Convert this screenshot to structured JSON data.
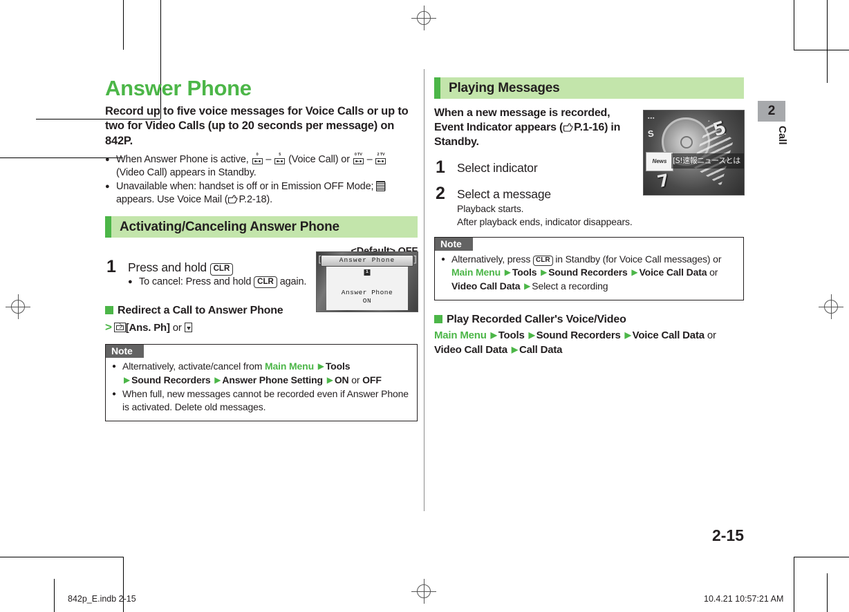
{
  "document": {
    "chapter_number": "2",
    "chapter_label": "Call",
    "page_number": "2-15",
    "footer_file": "842p_E.indb   2-15",
    "footer_timestamp": "10.4.21   10:57:21 AM",
    "accent_green": "#4cb648",
    "header_band_green": "#c3e5ab",
    "note_label_gray": "#636363",
    "tab_gray": "#a7a9ac"
  },
  "left": {
    "title": "Answer Phone",
    "lead": "Record up to five voice messages for Voice Calls or up to two for Video Calls (up to 20 seconds per message) on 842P.",
    "intro_bullets": [
      {
        "pre": "When Answer Phone is active, ",
        "icon1_sup": "0",
        "dash1": " – ",
        "icon2_sup": "5",
        "mid": " (Voice Call) or ",
        "icon3_sup": "0 TV",
        "dash2": " – ",
        "icon4_sup": "2 TV",
        "post": " (Video Call) appears in Standby."
      },
      {
        "pre": "Unavailable when: handset is off or in Emission OFF Mode; ",
        "post": " appears. Use Voice Mail (",
        "ref": "P.2-18",
        "tail": ")."
      }
    ],
    "section": {
      "heading": "Activating/Canceling Answer Phone",
      "default_line": "<Default> OFF",
      "steps": [
        {
          "num": "1",
          "head_pre": "Press and hold ",
          "head_key": "CLR",
          "bullet_pre": "To cancel: Press and hold ",
          "bullet_key": "CLR",
          "bullet_post": " again."
        }
      ],
      "screenshot": {
        "titlebar": "Answer Phone",
        "info_glyph": "i",
        "message_line1": "Answer Phone",
        "message_line2": "ON"
      }
    },
    "subsection": {
      "title": "Redirect a Call to Answer Phone",
      "path_prefix": ">",
      "path_label": "[Ans. Ph]",
      "path_or": "or"
    },
    "note": {
      "label": "Note",
      "bullets": [
        {
          "pre": "Alternatively, activate/cancel from ",
          "main_menu": "Main Menu",
          "crumbs": [
            "Tools",
            "Sound Recorders",
            "Answer Phone Setting"
          ],
          "tail_on": "ON",
          "tail_or": "or",
          "tail_off": "OFF"
        },
        {
          "text": "When full, new messages cannot be recorded even if Answer Phone is activated. Delete old messages."
        }
      ]
    }
  },
  "right": {
    "section": {
      "heading": "Playing Messages",
      "lead_pre": "When a new message is recorded, Event Indicator appears (",
      "lead_ref": "P.1-16",
      "lead_post": ") in Standby.",
      "steps": [
        {
          "num": "1",
          "head": "Select indicator",
          "subs": []
        },
        {
          "num": "2",
          "head": "Select a message",
          "subs": [
            "Playback starts.",
            "After playback ends, indicator disappears."
          ]
        }
      ],
      "screenshot": {
        "ticker": "[S!速報ニュースとは",
        "news_badge": "News",
        "dial_num_right": "5",
        "dial_num_left": "7",
        "small_s": "S"
      }
    },
    "note": {
      "label": "Note",
      "bullet": {
        "pre": "Alternatively, press ",
        "key": "CLR",
        "mid": " in Standby (for Voice Call messages) or",
        "main_menu": "Main Menu",
        "crumbs": [
          "Tools",
          "Sound Recorders",
          "Voice Call Data"
        ],
        "or": "or",
        "crumb_alt": "Video Call Data",
        "tail": "Select a recording"
      }
    },
    "subsection": {
      "title": "Play Recorded Caller's Voice/Video",
      "main_menu": "Main Menu",
      "crumbs": [
        "Tools",
        "Sound Recorders",
        "Voice Call Data"
      ],
      "or": "or",
      "crumb_alt": "Video Call Data",
      "tail": "Call Data"
    }
  }
}
